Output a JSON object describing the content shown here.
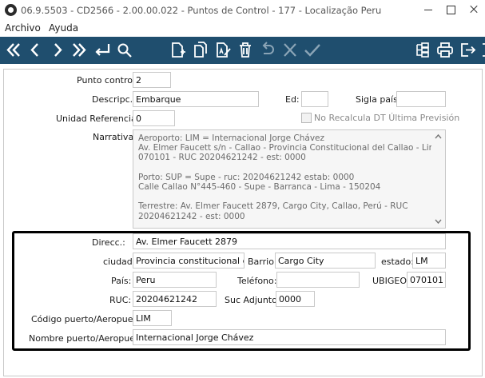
{
  "window": {
    "title": "06.9.5503 - CD2566 - 2.00.00.022 - Puntos de Control - 177 - Localização Peru"
  },
  "menu": {
    "items": [
      "Archivo",
      "Ayuda"
    ]
  },
  "toolbar": {
    "bg": "#1f4e6e",
    "icons": [
      "first-record-icon",
      "previous-record-icon",
      "next-record-icon",
      "last-record-icon",
      "return-icon",
      "search-icon",
      "new-document-icon",
      "copy-document-icon",
      "edit-document-icon",
      "delete-icon",
      "undo-icon",
      "cancel-icon",
      "confirm-icon",
      "tree-structure-icon",
      "print-icon",
      "exit-icon",
      "exit-alt-icon"
    ]
  },
  "form": {
    "punto_control": {
      "label": "Punto control:",
      "value": "2"
    },
    "descripc": {
      "label": "Descripc.:",
      "value": "Embarque"
    },
    "ed": {
      "label": "Ed:",
      "value": ""
    },
    "sigla_pais": {
      "label": "Sigla país:",
      "value": ""
    },
    "unidad_referencial": {
      "label": "Unidad Referencial:",
      "value": "0"
    },
    "no_recalcula": {
      "label": "No Recalcula DT Última Previsión",
      "checked": false
    },
    "narrativa": {
      "label": "Narrativa:",
      "lines": [
        "Aeroporto: LIM = Internacional Jorge Chávez",
        "Av. Elmer Faucett s/n - Callao - Provincia Constitucional del Callao - Lima -",
        "070101 - RUC 20204621242 - est: 0000",
        "",
        "Porto: SUP = Supe - ruc: 20204621242 estab: 0000",
        "Calle Callao N°445-460 - Supe - Barranca - Lima - 150204",
        "",
        "Terrestre: Av. Elmer Faucett 2879, Cargo City, Callao, Perú - RUC",
        "20204621242 - est: 0000"
      ]
    },
    "direcc": {
      "label": "Direcc.:",
      "value": "Av. Elmer Faucett 2879"
    },
    "ciudad": {
      "label": "ciudad:",
      "value": "Provincia constitucional del Callao"
    },
    "barrio": {
      "label": "Barrio:",
      "value": "Cargo City"
    },
    "estado": {
      "label": "estado:",
      "value": "LM"
    },
    "pais": {
      "label": "País:",
      "value": "Peru"
    },
    "telefono": {
      "label": "Teléfono:",
      "value": ""
    },
    "ubigeo": {
      "label": "UBIGEO:",
      "value": "070101"
    },
    "ruc": {
      "label": "RUC:",
      "value": "20204621242"
    },
    "suc_adjunto": {
      "label": "Suc Adjunto:",
      "value": "0000"
    },
    "codigo_puerto": {
      "label": "Código puerto/Aeropuert:",
      "value": "LIM"
    },
    "nombre_puerto": {
      "label": "Nombre puerto/Aeropuert:",
      "value": "Internacional Jorge Chávez"
    }
  }
}
